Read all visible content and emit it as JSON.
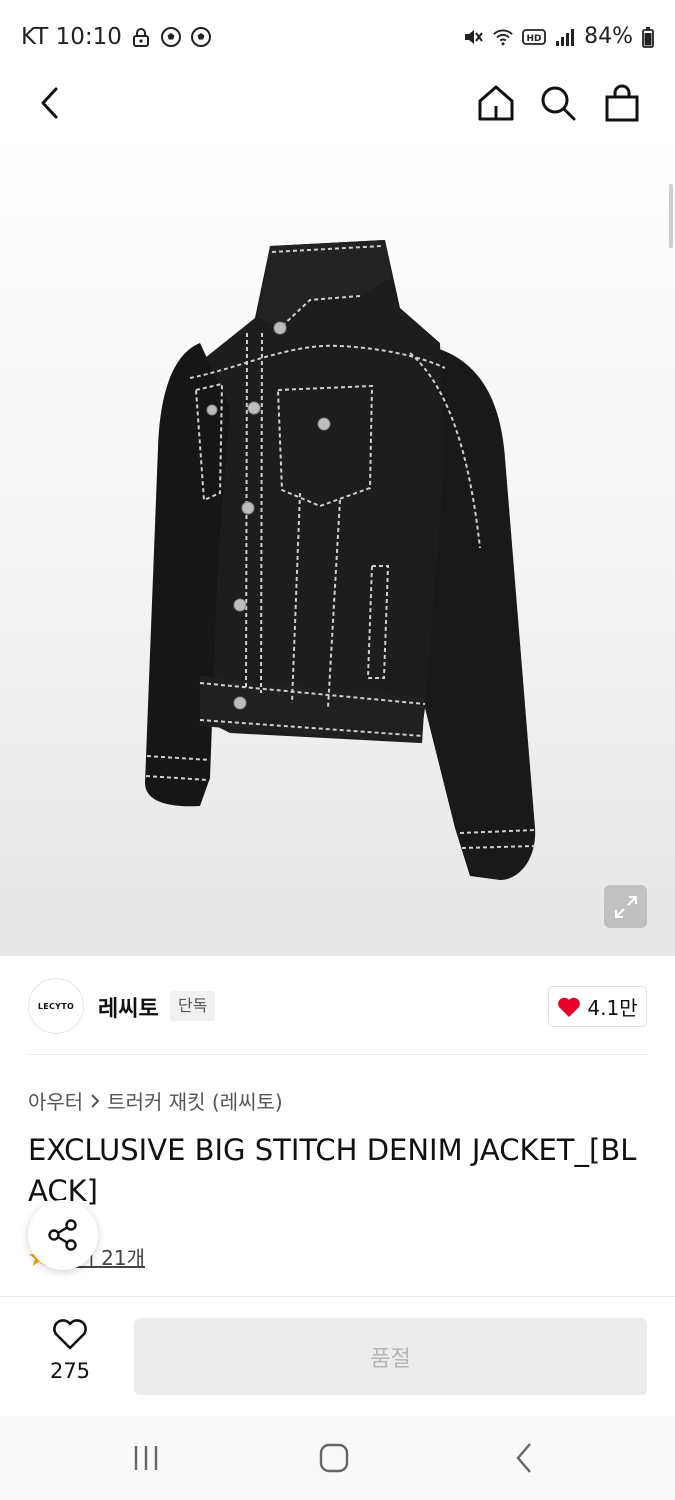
{
  "status_bar": {
    "carrier_time": "KT 10:10",
    "battery": "84%",
    "left_icons": [
      "lock-icon",
      "soccer-ball-icon",
      "soccer-ball-icon"
    ],
    "right_icons": [
      "mute-icon",
      "wifi-icon",
      "hd-icon",
      "signal-icon",
      "battery-icon"
    ]
  },
  "header": {
    "icons": [
      "back-arrow-icon",
      "home-icon",
      "search-icon",
      "shopping-bag-icon"
    ]
  },
  "product": {
    "image_alt": "black denim jacket",
    "brand_logo_text": "LECYTO",
    "brand_name": "레씨토",
    "brand_badge": "단독",
    "brand_likes": "4.1만",
    "breadcrumb": {
      "category": "아우터",
      "subcategory": "트러커 재킷 (레씨토)"
    },
    "title": "EXCLUSIVE BIG STITCH DENIM JACKET_[BLACK]",
    "reviews_label": "후기 21개"
  },
  "bottom_bar": {
    "wish_count": "275",
    "buy_button": "품절"
  },
  "colors": {
    "heart": "#e4002b",
    "star": "#f5a623",
    "disabled_button_bg": "#ececec",
    "disabled_button_text": "#b5b5b5"
  }
}
